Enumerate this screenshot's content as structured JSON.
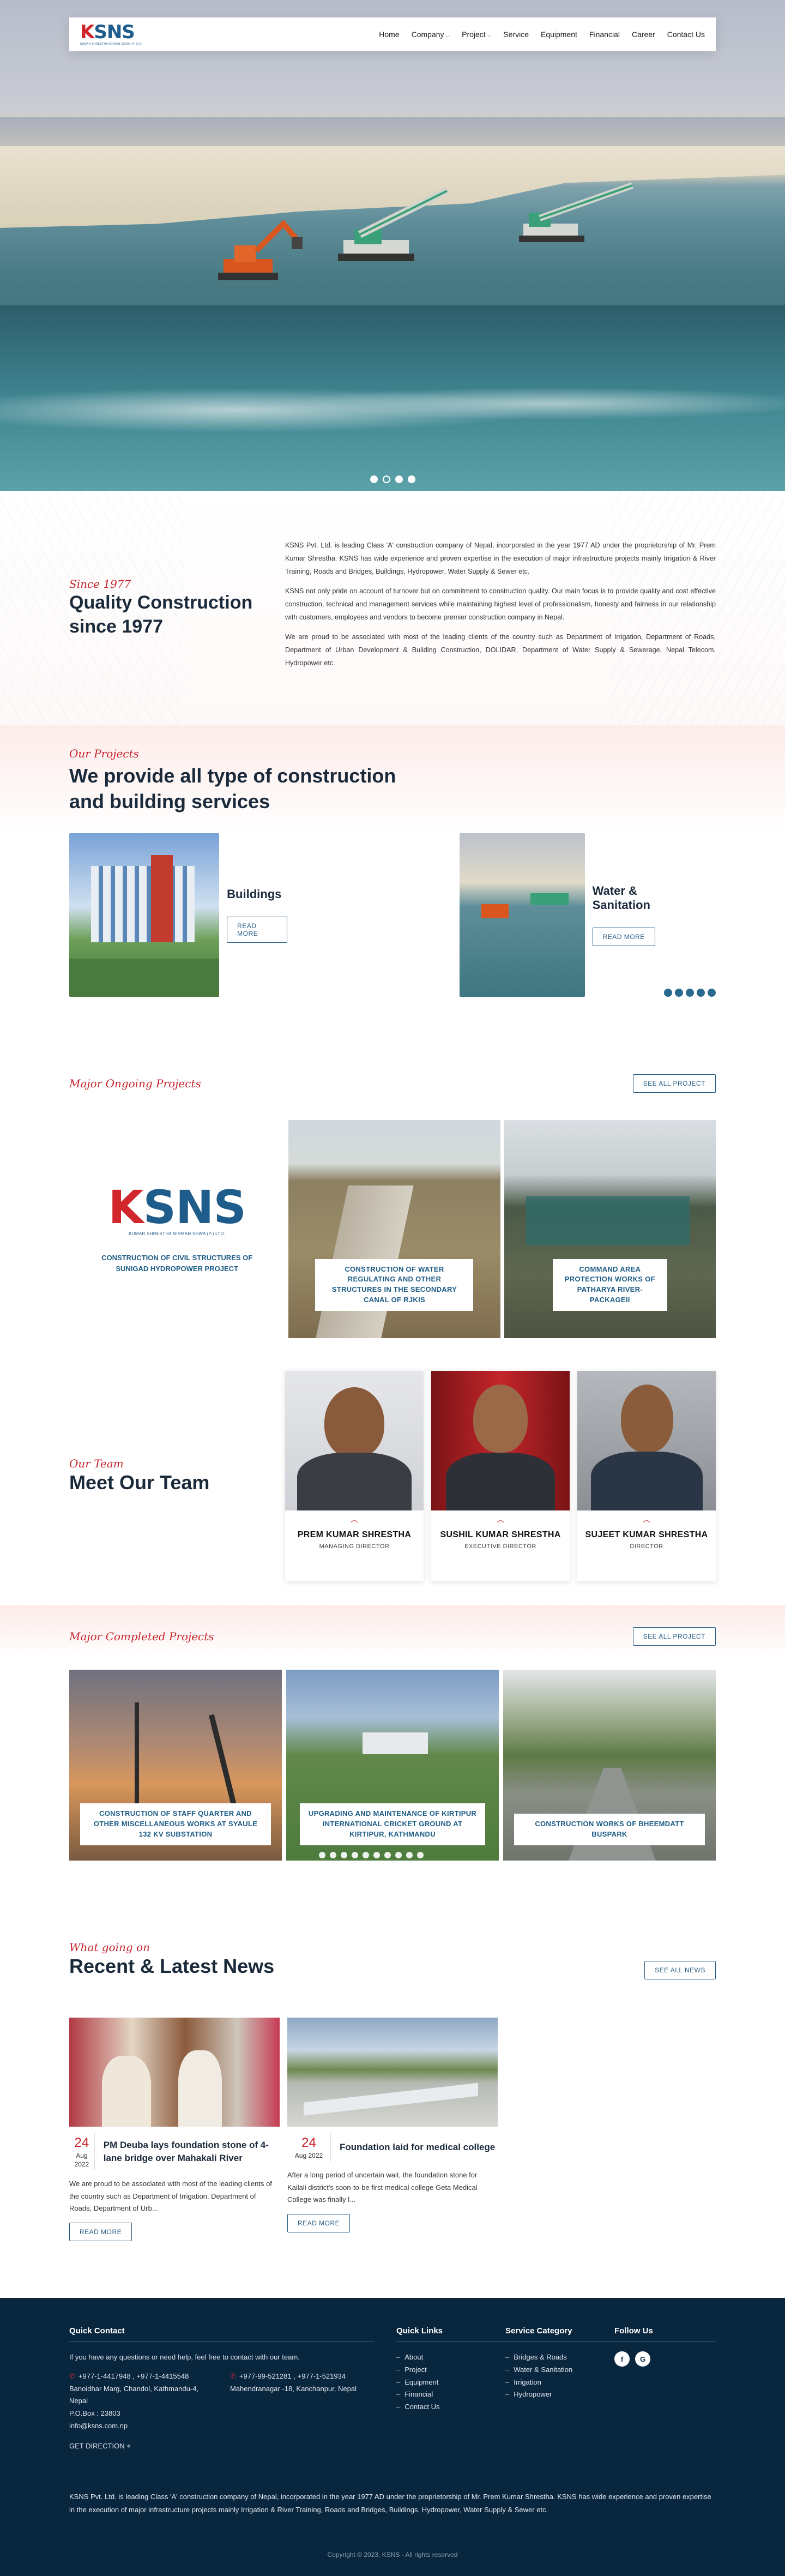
{
  "nav": {
    "logo": "KSNS",
    "logo_sub": "KUMAR SHRESTHA NIRMAN SEWA (P.) LTD.",
    "items": [
      {
        "label": "Home",
        "dropdown": false
      },
      {
        "label": "Company",
        "dropdown": true
      },
      {
        "label": "Project",
        "dropdown": true
      },
      {
        "label": "Service",
        "dropdown": false
      },
      {
        "label": "Equipment",
        "dropdown": false
      },
      {
        "label": "Financial",
        "dropdown": false
      },
      {
        "label": "Career",
        "dropdown": false
      },
      {
        "label": "Contact Us",
        "dropdown": false
      }
    ]
  },
  "about": {
    "eyebrow": "Since 1977",
    "title": "Quality Construction since 1977",
    "p1": "KSNS Pvt. Ltd. is leading Class 'A' construction company of Nepal, incorporated in the year 1977 AD under the proprietorship of Mr. Prem Kumar Shrestha. KSNS has wide experience and proven expertise in the execution of major infrastructure projects mainly Irrigation & River Training, Roads and Bridges, Buildings, Hydropower, Water Supply & Sewer etc.",
    "p2": "KSNS not only pride on account of turnover but on commitment to construction quality. Our main focus is to provide quality and cost effective construction, technical and management services while maintaining highest level of professionalism, honesty and fairness in our relationship with customers, employees and vendors to become premier construction company in Nepal.",
    "p3": "We are proud to be associated with most of the leading clients of the country such as Department of Irrigation, Department of Roads, Department of Urban Development & Building Construction, DOLIDAR, Department of Water Supply & Sewerage, Nepal Telecom, Hydropower etc."
  },
  "project_types": {
    "eyebrow": "Our Projects",
    "title": "We provide all type of construction and building services",
    "cards": [
      {
        "title": "Buildings",
        "button": "READ MORE"
      },
      {
        "title": "Water & Sanitation",
        "button": "READ MORE"
      }
    ]
  },
  "ongoing": {
    "eyebrow": "Major Ongoing Projects",
    "button": "SEE ALL PROJECT",
    "items": [
      "CONSTRUCTION OF CIVIL STRUCTURES OF SUNIGAD HYDROPOWER PROJECT",
      "CONSTRUCTION OF WATER REGULATING AND OTHER STRUCTURES IN THE SECONDARY CANAL OF RJKIS",
      "COMMAND AREA PROTECTION WORKS OF PATHARYA RIVER-PACKAGEII"
    ]
  },
  "team": {
    "eyebrow": "Our Team",
    "title": "Meet Our Team",
    "members": [
      {
        "name": "PREM KUMAR SHRESTHA",
        "role": "MANAGING DIRECTOR"
      },
      {
        "name": "SUSHIL KUMAR SHRESTHA",
        "role": "EXECUTIVE DIRECTOR"
      },
      {
        "name": "SUJEET KUMAR SHRESTHA",
        "role": "DIRECTOR"
      }
    ]
  },
  "completed": {
    "eyebrow": "Major Completed Projects",
    "button": "SEE ALL PROJECT",
    "items": [
      "CONSTRUCTION OF STAFF QUARTER AND OTHER MISCELLANEOUS WORKS AT SYAULE 132 KV SUBSTATION",
      "UPGRADING AND MAINTENANCE OF KIRTIPUR INTERNATIONAL CRICKET GROUND AT KIRTIPUR, KATHMANDU",
      "CONSTRUCTION WORKS OF BHEEMDATT BUSPARK"
    ]
  },
  "news": {
    "eyebrow": "What going on",
    "title": "Recent & Latest News",
    "button": "SEE ALL NEWS",
    "items": [
      {
        "day": "24",
        "month": "Aug 2022",
        "title": "PM Deuba lays foundation stone of 4-lane bridge over Mahakali River",
        "excerpt": "We are proud to be associated with most of the leading clients of the country such as Department of Irrigation, Department of Roads, Department of Urb...",
        "button": "READ MORE"
      },
      {
        "day": "24",
        "month": "Aug 2022",
        "title": "Foundation laid for medical college",
        "excerpt": "After a long period of uncertain wait, the foundation stone for Kailali district's soon-to-be first medical college Geta Medical College was finally l...",
        "button": "READ MORE"
      }
    ]
  },
  "footer": {
    "quick_contact": {
      "title": "Quick Contact",
      "intro": "If you have any questions or need help, feel free to contact with our team.",
      "office1": {
        "phones": "+977-1-4417948 , +977-1-4415548",
        "address": "Banoidhar Marg, Chandol, Kathmandu-4, Nepal"
      },
      "office2": {
        "phones": "+977-99-521281 , +977-1-521934",
        "address": "Mahendranagar -18, Kanchanpur, Nepal"
      },
      "pobox": "P.O.Box : 23803",
      "email": "info@ksns.com.np",
      "directions": "GET DIRECTION"
    },
    "quick_links": {
      "title": "Quick Links",
      "items": [
        "About",
        "Project",
        "Equipment",
        "Financial",
        "Contact Us"
      ]
    },
    "service_category": {
      "title": "Service Category",
      "items": [
        "Bridges & Roads",
        "Water & Sanitation",
        "Irrigation",
        "Hydropower"
      ]
    },
    "follow": {
      "title": "Follow Us",
      "items": [
        "f",
        "G"
      ]
    },
    "about": "KSNS Pvt. Ltd. is leading Class 'A' construction company of Nepal, incorporated in the year 1977 AD under the proprietorship of Mr. Prem Kumar Shrestha. KSNS has wide experience and proven expertise in the execution of major infrastructure projects mainly Irrigation & River Training, Roads and Bridges, Buildings, Hydropower, Water Supply & Sewer etc.",
    "copyright": "Copyright © 2023, KSNS - All rights reserved"
  }
}
